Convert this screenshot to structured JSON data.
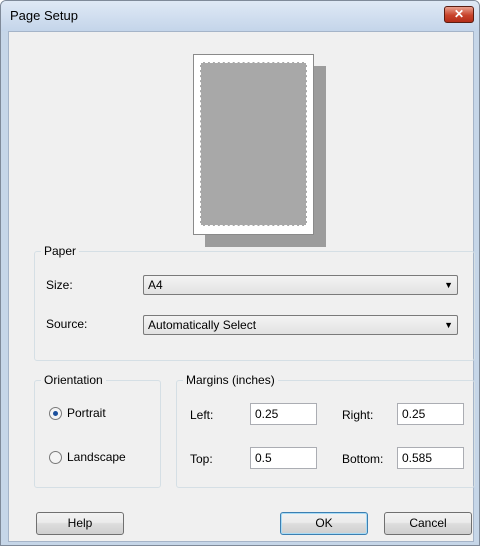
{
  "window": {
    "title": "Page Setup",
    "close_glyph": "✕"
  },
  "paper": {
    "group_label": "Paper",
    "size_label": "Size:",
    "size_value": "A4",
    "source_label": "Source:",
    "source_value": "Automatically Select"
  },
  "orientation": {
    "group_label": "Orientation",
    "portrait_label": "Portrait",
    "landscape_label": "Landscape",
    "selected": "Portrait"
  },
  "margins": {
    "group_label": "Margins (inches)",
    "left_label": "Left:",
    "left_value": "0.25",
    "right_label": "Right:",
    "right_value": "0.25",
    "top_label": "Top:",
    "top_value": "0.5",
    "bottom_label": "Bottom:",
    "bottom_value": "0.585"
  },
  "buttons": {
    "help": "Help",
    "ok": "OK",
    "cancel": "Cancel"
  },
  "icons": {
    "dropdown": "chevron-down-icon",
    "close": "close-icon"
  }
}
